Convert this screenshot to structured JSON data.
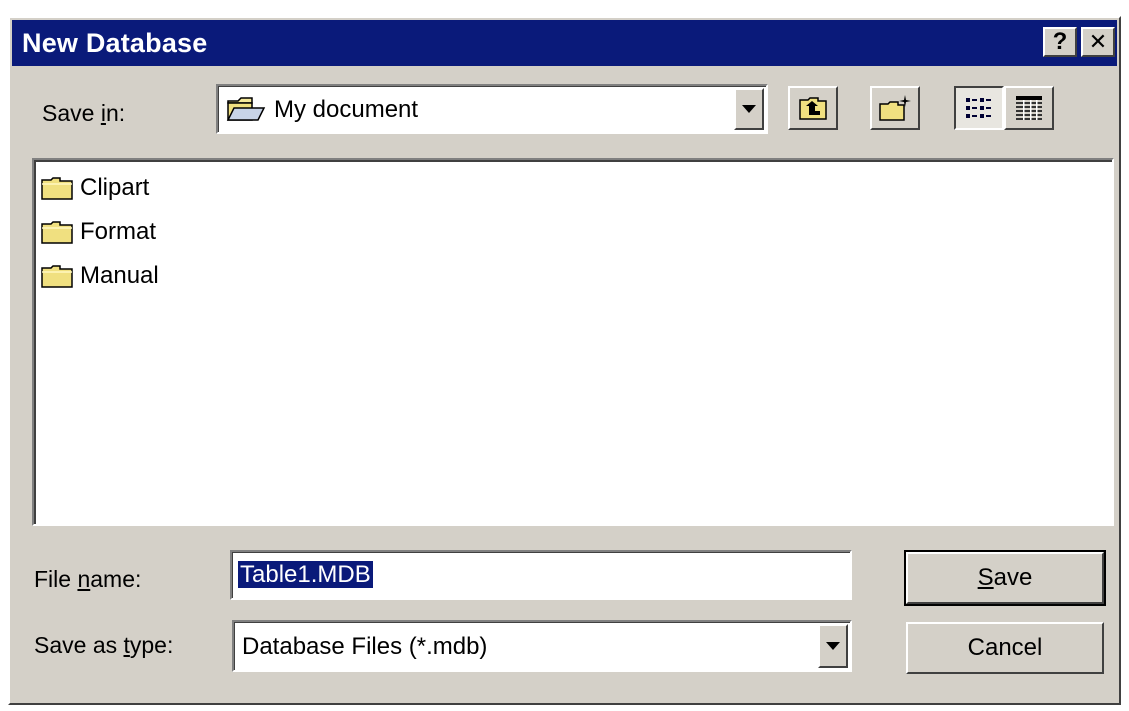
{
  "window": {
    "title": "New Database",
    "help_label": "?",
    "close_label": "✕"
  },
  "save_in": {
    "label_prefix": "Save ",
    "label_key": "i",
    "label_suffix": "n:",
    "value": "My document"
  },
  "files": [
    {
      "name": "Clipart"
    },
    {
      "name": "Format"
    },
    {
      "name": "Manual"
    }
  ],
  "file_name": {
    "label_prefix": "File ",
    "label_key": "n",
    "label_suffix": "ame:",
    "value": "Table1.MDB"
  },
  "save_as_type": {
    "label_prefix": "Save as ",
    "label_key": "t",
    "label_suffix": "ype:",
    "value": "Database Files (*.mdb)"
  },
  "buttons": {
    "save_key": "S",
    "save_rest": "ave",
    "cancel": "Cancel"
  },
  "colors": {
    "titlebar": "#0a1a7a",
    "face": "#d4d0c8",
    "selection": "#0a1a7a"
  },
  "icons": [
    "folder-icon",
    "up-one-level-icon",
    "create-new-folder-icon",
    "list-view-icon",
    "details-view-icon",
    "dropdown-arrow-icon"
  ]
}
